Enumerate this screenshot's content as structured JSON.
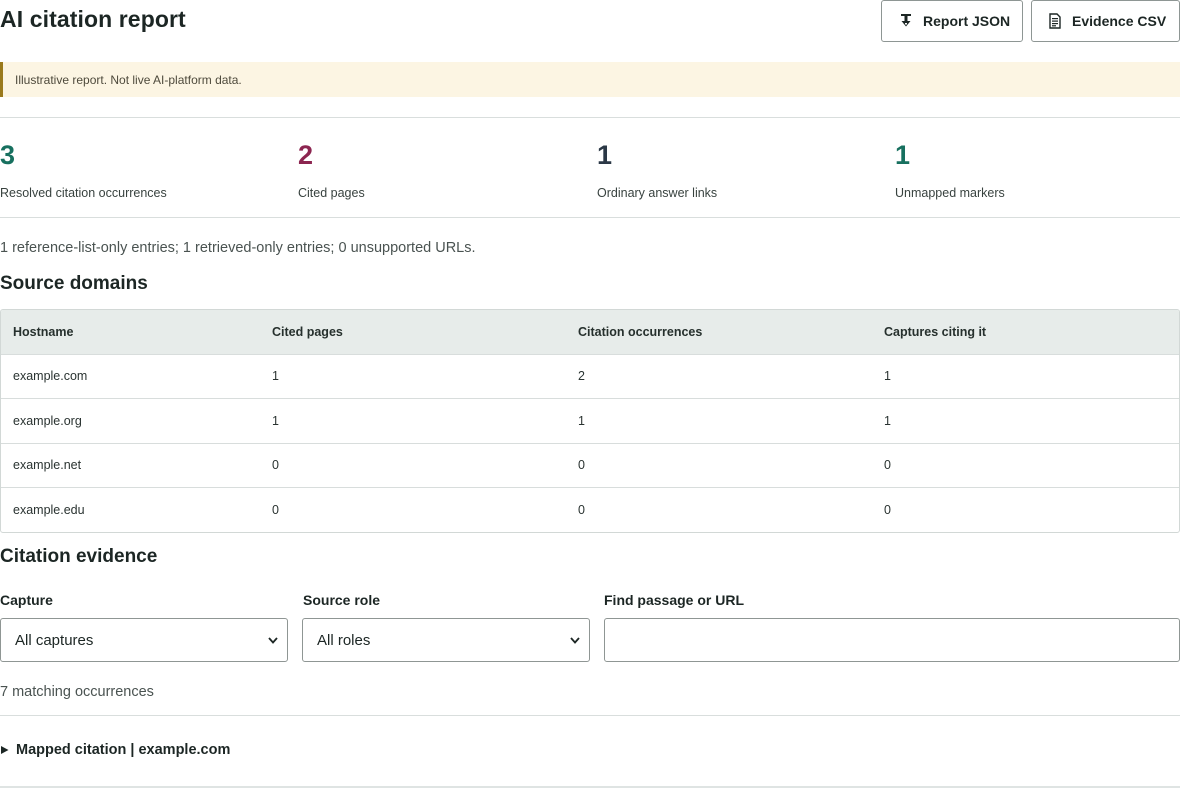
{
  "header": {
    "title": "AI citation report",
    "report_json_label": "Report JSON",
    "evidence_csv_label": "Evidence CSV"
  },
  "notice": {
    "text": "Illustrative report. Not live AI-platform data."
  },
  "stats": [
    {
      "value": "3",
      "label": "Resolved citation occurrences",
      "color": "#17705f"
    },
    {
      "value": "2",
      "label": "Cited pages",
      "color": "#8c2550"
    },
    {
      "value": "1",
      "label": "Ordinary answer links",
      "color": "#2b3846"
    },
    {
      "value": "1",
      "label": "Unmapped markers",
      "color": "#17705f"
    }
  ],
  "summary": "1 reference-list-only entries; 1 retrieved-only entries; 0 unsupported URLs.",
  "source_domains": {
    "title": "Source domains",
    "columns": [
      "Hostname",
      "Cited pages",
      "Citation occurrences",
      "Captures citing it"
    ],
    "rows": [
      [
        "example.com",
        "1",
        "2",
        "1"
      ],
      [
        "example.org",
        "1",
        "1",
        "1"
      ],
      [
        "example.net",
        "0",
        "0",
        "0"
      ],
      [
        "example.edu",
        "0",
        "0",
        "0"
      ]
    ]
  },
  "evidence": {
    "title": "Citation evidence",
    "capture_label": "Capture",
    "capture_value": "All captures",
    "role_label": "Source role",
    "role_value": "All roles",
    "find_label": "Find passage or URL",
    "find_value": "",
    "match_count": "7 matching occurrences",
    "first_item": "Mapped citation | example.com"
  }
}
